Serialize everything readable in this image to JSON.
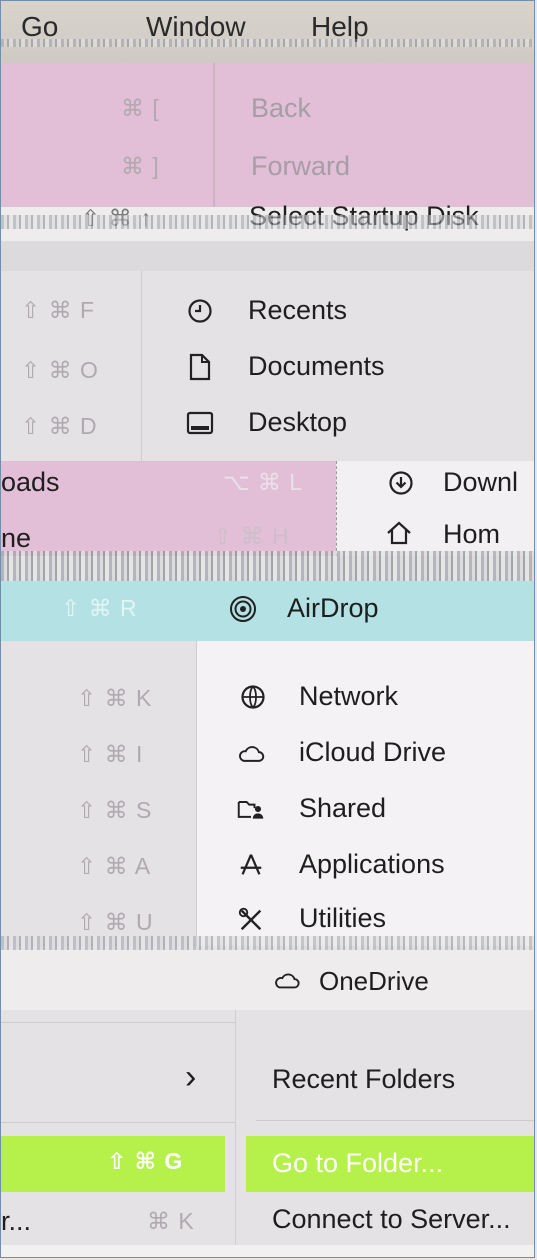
{
  "menubar": {
    "items": [
      "Go",
      "Window",
      "Help"
    ]
  },
  "nav": [
    {
      "label": "Back",
      "shortcut": "⌘ ["
    },
    {
      "label": "Forward",
      "shortcut": "⌘ ]"
    },
    {
      "label": "Select Startup Disk",
      "shortcut": "⇧ ⌘ ↑"
    }
  ],
  "places": [
    {
      "label": "Recents",
      "shortcut": "⇧ ⌘ F",
      "icon": "clock-icon"
    },
    {
      "label": "Documents",
      "shortcut": "⇧ ⌘ O",
      "icon": "document-icon"
    },
    {
      "label": "Desktop",
      "shortcut": "⇧ ⌘ D",
      "icon": "desktop-icon"
    },
    {
      "label": "Downloads",
      "shortcut": "⌥ ⌘ L",
      "icon": "download-icon",
      "left_fragment": "oads",
      "right_fragment": "Downl"
    },
    {
      "label": "Home",
      "shortcut": "⇧ ⌘ H",
      "icon": "home-icon",
      "left_fragment": "ne",
      "right_fragment": "Hom"
    }
  ],
  "locations": [
    {
      "label": "AirDrop",
      "shortcut": "⇧ ⌘ R",
      "icon": "airdrop-icon"
    },
    {
      "label": "Network",
      "shortcut": "⇧ ⌘ K",
      "icon": "network-icon"
    },
    {
      "label": "iCloud Drive",
      "shortcut": "⇧ ⌘ I",
      "icon": "cloud-icon"
    },
    {
      "label": "Shared",
      "shortcut": "⇧ ⌘ S",
      "icon": "shared-folder-icon"
    },
    {
      "label": "Applications",
      "shortcut": "⇧ ⌘ A",
      "icon": "applications-icon"
    },
    {
      "label": "Utilities",
      "shortcut": "⇧ ⌘ U",
      "icon": "utilities-icon"
    }
  ],
  "extra": {
    "onedrive": "OneDrive",
    "recent_folders": "Recent Folders",
    "recent_chevron": "›",
    "go_to_folder": "Go to Folder...",
    "go_to_folder_shortcut": "⇧ ⌘ G",
    "connect": "Connect to Server...",
    "connect_fragment": "r...",
    "connect_shortcut": "⌘ K"
  },
  "colors": {
    "highlight": "#b6f04a",
    "pink": "#e2bfd7",
    "teal": "#b4e1e3"
  }
}
